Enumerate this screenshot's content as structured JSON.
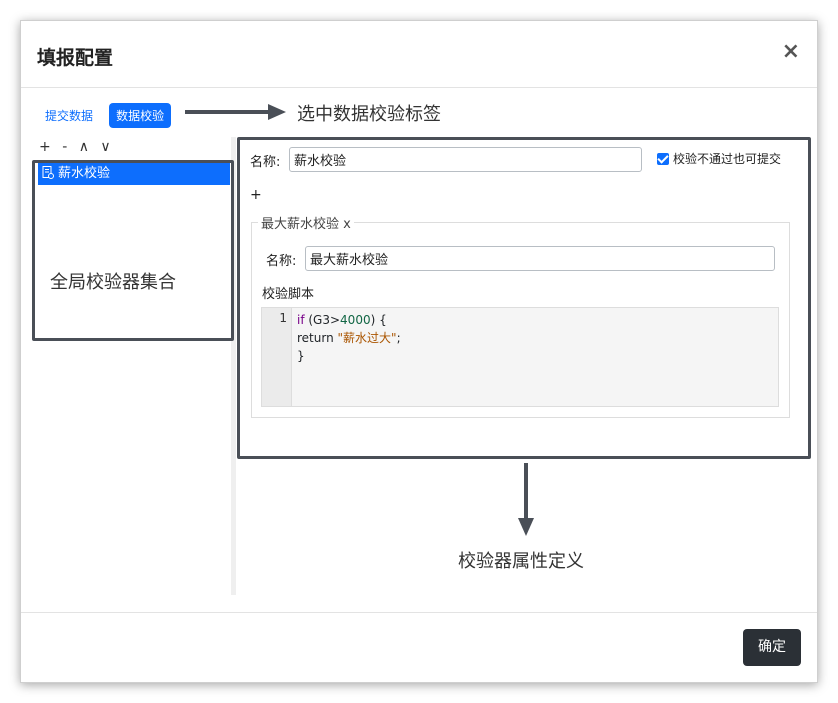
{
  "dialog": {
    "title": "填报配置",
    "close_label": "×",
    "ok_label": "确定"
  },
  "tabs": [
    {
      "label": "提交数据",
      "active": false
    },
    {
      "label": "数据校验",
      "active": true
    }
  ],
  "toolbar": {
    "add": "+",
    "remove": "-",
    "up": "∧",
    "down": "∨"
  },
  "validators": [
    {
      "label": "薪水校验",
      "selected": true,
      "icon": "file-icon"
    }
  ],
  "detail": {
    "name_label": "名称:",
    "name_value": "薪水校验",
    "allow_submit_label": "校验不通过也可提交",
    "allow_submit_checked": true,
    "add_rule": "+",
    "rule": {
      "legend": "最大薪水校验 x",
      "name_label": "名称:",
      "name_value": "最大薪水校验",
      "script_label": "校验脚本",
      "line_number": "1",
      "code": {
        "line1_kw": "if",
        "line1_open": " (G3>",
        "line1_num": "4000",
        "line1_close": ")  {",
        "line2_kw": "return",
        "line2_str": "\"薪水过大\"",
        "line2_end": ";",
        "line3": "}"
      }
    }
  },
  "annotations": {
    "tab_hint": "选中数据校验标签",
    "list_hint": "全局校验器集合",
    "props_hint": "校验器属性定义",
    "color": "#4a4f57"
  },
  "colors": {
    "accent": "#0d6efd",
    "dark_button": "#2b3036"
  }
}
